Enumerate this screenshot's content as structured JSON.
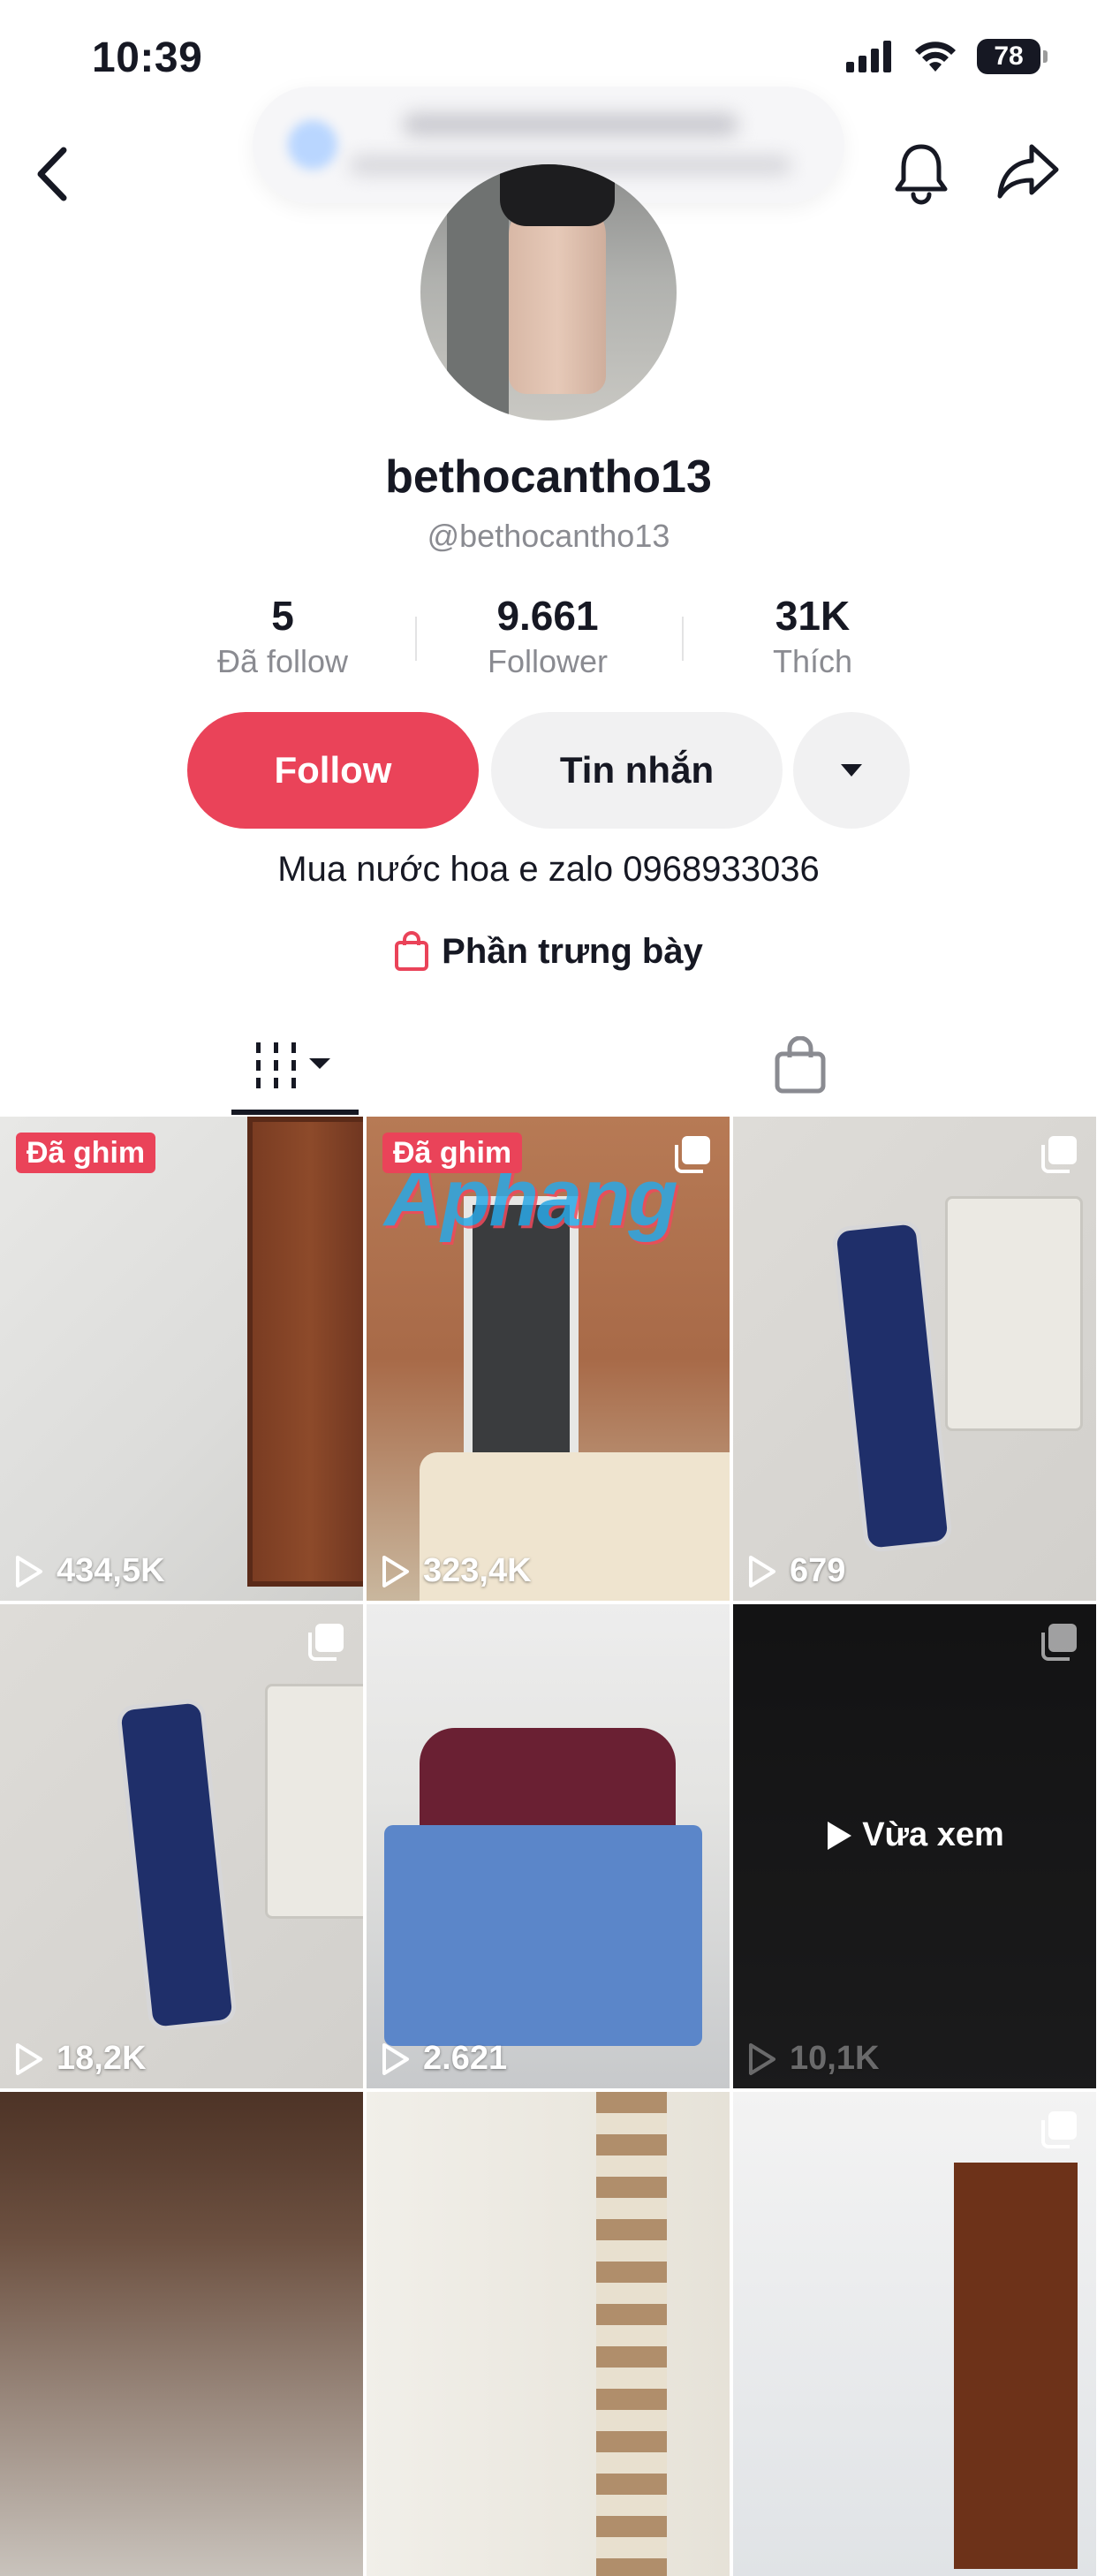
{
  "status_bar": {
    "time": "10:39",
    "battery": "78"
  },
  "profile": {
    "display_name": "bethocantho13",
    "handle": "@bethocantho13",
    "bio": "Mua nước hoa e zalo 0968933036",
    "showcase_label": "Phần trưng bày"
  },
  "stats": [
    {
      "value": "5",
      "label": "Đã follow"
    },
    {
      "value": "9.661",
      "label": "Follower"
    },
    {
      "value": "31K",
      "label": "Thích"
    }
  ],
  "actions": {
    "follow_label": "Follow",
    "message_label": "Tin nhắn"
  },
  "videos": [
    {
      "views": "434,5K",
      "pinned": "Đã ghim"
    },
    {
      "views": "323,4K",
      "pinned": "Đã ghim",
      "watermark": "Aphang"
    },
    {
      "views": "679"
    },
    {
      "views": "18,2K"
    },
    {
      "views": "2.621"
    },
    {
      "views": "10,1K",
      "overlay": "Vừa xem"
    },
    {},
    {},
    {}
  ],
  "colors": {
    "accent": "#ea4359",
    "text_primary": "#161823",
    "text_secondary": "#8a8b91",
    "button_gray": "#f1f1f2"
  },
  "icons": {
    "back": "back-arrow-icon",
    "bell": "bell-icon",
    "share": "share-icon",
    "dropdown": "caret-down-icon",
    "grid": "grid-icon",
    "shop": "shopping-bag-icon",
    "play": "play-icon",
    "multi": "multi-image-icon"
  }
}
